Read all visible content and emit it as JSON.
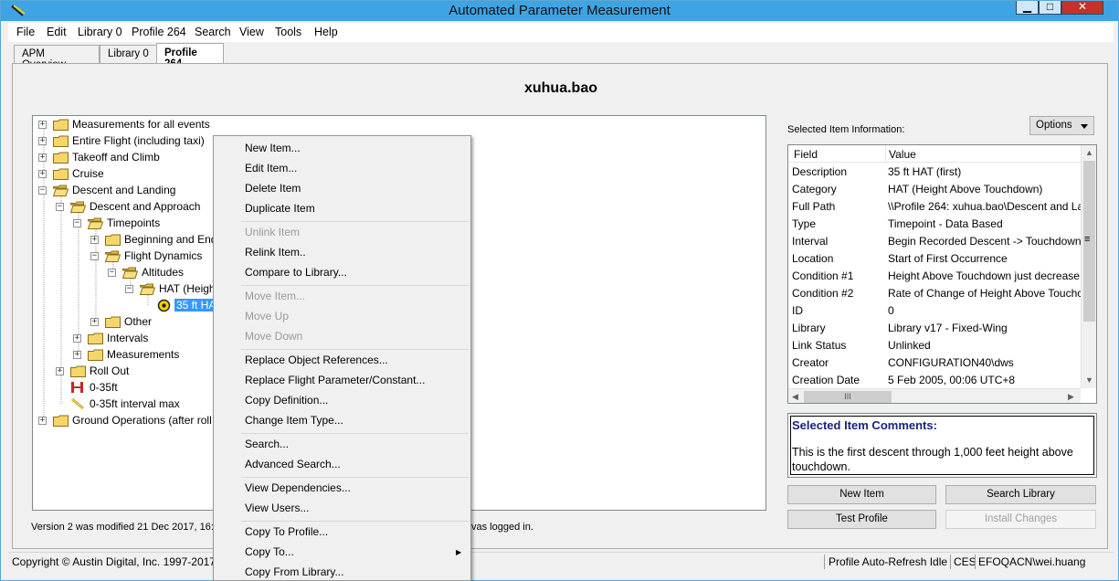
{
  "window": {
    "title": "Automated Parameter Measurement",
    "controls": {
      "minimize": "▁",
      "maximize": "□",
      "close": "✕"
    }
  },
  "menubar": [
    "File",
    "Edit",
    "Library 0",
    "Profile 264",
    "Search",
    "View",
    "Tools",
    "Help"
  ],
  "tabs": [
    {
      "label": "APM Overview",
      "active": false
    },
    {
      "label": "Library 0",
      "active": false
    },
    {
      "label": "Profile 264",
      "active": true
    }
  ],
  "profile_owner": "xuhua.bao",
  "tree": [
    {
      "label": "Measurements for all events",
      "level": 0,
      "expander": "+",
      "icon": "folder-icon"
    },
    {
      "label": "Entire Flight (including taxi)",
      "level": 0,
      "expander": "+",
      "icon": "folder-icon"
    },
    {
      "label": "Takeoff and Climb",
      "level": 0,
      "expander": "+",
      "icon": "folder-icon"
    },
    {
      "label": "Cruise",
      "level": 0,
      "expander": "+",
      "icon": "folder-icon"
    },
    {
      "label": "Descent and Landing",
      "level": 0,
      "expander": "−",
      "icon": "folder-open-icon"
    },
    {
      "label": "Descent and Approach",
      "level": 1,
      "expander": "−",
      "icon": "folder-open-icon"
    },
    {
      "label": "Timepoints",
      "level": 2,
      "expander": "−",
      "icon": "folder-open-icon"
    },
    {
      "label": "Beginning and End",
      "level": 3,
      "expander": "+",
      "icon": "folder-icon"
    },
    {
      "label": "Flight Dynamics",
      "level": 3,
      "expander": "−",
      "icon": "folder-open-icon"
    },
    {
      "label": "Altitudes",
      "level": 4,
      "expander": "−",
      "icon": "folder-open-icon"
    },
    {
      "label": "HAT (Heigh",
      "level": 5,
      "expander": "−",
      "icon": "folder-open-icon"
    },
    {
      "label": "35 ft HA",
      "level": 6,
      "expander": "",
      "icon": "timepoint-icon",
      "selected": true
    },
    {
      "label": "Other",
      "level": 3,
      "expander": "+",
      "icon": "folder-icon"
    },
    {
      "label": "Intervals",
      "level": 2,
      "expander": "+",
      "icon": "folder-icon"
    },
    {
      "label": "Measurements",
      "level": 2,
      "expander": "+",
      "icon": "folder-icon"
    },
    {
      "label": "Roll Out",
      "level": 1,
      "expander": "+",
      "icon": "folder-icon"
    },
    {
      "label": "0-35ft",
      "level": 1,
      "expander": "",
      "icon": "interval-icon"
    },
    {
      "label": "0-35ft interval max",
      "level": 1,
      "expander": "",
      "icon": "measurement-icon"
    },
    {
      "label": "Ground Operations (after roll",
      "level": 0,
      "expander": "+",
      "icon": "folder-icon"
    }
  ],
  "status_line": {
    "left": "Version 2 was modified 21 Dec 2017, 16:2",
    "right": "vas logged in."
  },
  "context_menu": {
    "groups": [
      [
        {
          "label": "New Item...",
          "enabled": true
        },
        {
          "label": "Edit Item...",
          "enabled": true
        },
        {
          "label": "Delete Item",
          "enabled": true
        },
        {
          "label": "Duplicate Item",
          "enabled": true
        }
      ],
      [
        {
          "label": "Unlink Item",
          "enabled": false
        },
        {
          "label": "Relink Item..",
          "enabled": true
        },
        {
          "label": "Compare to Library...",
          "enabled": true
        }
      ],
      [
        {
          "label": "Move Item...",
          "enabled": false
        },
        {
          "label": "Move Up",
          "enabled": false
        },
        {
          "label": "Move Down",
          "enabled": false
        }
      ],
      [
        {
          "label": "Replace Object References...",
          "enabled": true
        },
        {
          "label": "Replace Flight Parameter/Constant...",
          "enabled": true
        },
        {
          "label": "Copy Definition...",
          "enabled": true
        },
        {
          "label": "Change Item Type...",
          "enabled": true
        }
      ],
      [
        {
          "label": "Search...",
          "enabled": true
        },
        {
          "label": "Advanced Search...",
          "enabled": true
        }
      ],
      [
        {
          "label": "View Dependencies...",
          "enabled": true
        },
        {
          "label": "View Users...",
          "enabled": true
        }
      ],
      [
        {
          "label": "Copy To Profile...",
          "enabled": true
        },
        {
          "label": "Copy To...",
          "enabled": true,
          "submenu": true
        },
        {
          "label": "Copy From Library...",
          "enabled": true
        }
      ]
    ],
    "submenu_arrow": "▶"
  },
  "selected_item": {
    "label": "Selected Item Information:",
    "options_label": "Options",
    "columns": {
      "field": "Field",
      "value": "Value"
    },
    "rows": [
      {
        "field": "Description",
        "value": "35 ft HAT (first)"
      },
      {
        "field": "Category",
        "value": "HAT (Height Above Touchdown)"
      },
      {
        "field": "Full Path",
        "value": "\\\\Profile 264: xuhua.bao\\Descent and La"
      },
      {
        "field": "Type",
        "value": "Timepoint - Data Based"
      },
      {
        "field": "Interval",
        "value": "Begin Recorded Descent -> Touchdown"
      },
      {
        "field": "Location",
        "value": "Start of First Occurrence"
      },
      {
        "field": "Condition #1",
        "value": "Height Above Touchdown just decrease"
      },
      {
        "field": "Condition #2",
        "value": "Rate of Change of Height Above Touchc"
      },
      {
        "field": "ID",
        "value": "0"
      },
      {
        "field": "Library",
        "value": "Library v17 - Fixed-Wing"
      },
      {
        "field": "Link Status",
        "value": "Unlinked"
      },
      {
        "field": "Creator",
        "value": "CONFIGURATION40\\dws"
      },
      {
        "field": "Creation Date",
        "value": "5 Feb 2005, 00:06 UTC+8"
      }
    ],
    "scroll_grip": "III",
    "scroll_grip_v": "≡"
  },
  "comments": {
    "title": "Selected Item Comments:",
    "text": "This is the first descent through 1,000 feet height above touchdown."
  },
  "action_buttons": {
    "new_item": "New Item",
    "search_library": "Search Library",
    "test_profile": "Test Profile",
    "install_changes": "Install Changes"
  },
  "statusbar": {
    "copyright": "Copyright © Austin Digital, Inc. 1997-2017",
    "refresh": "Profile Auto-Refresh Idle",
    "ces": "CES",
    "user": "EFOQACN\\wei.huang"
  },
  "colors": {
    "titlebar": "#3fa4e3",
    "selection": "#3399ff",
    "close": "#c7312a",
    "comment_title": "#1a237e"
  }
}
